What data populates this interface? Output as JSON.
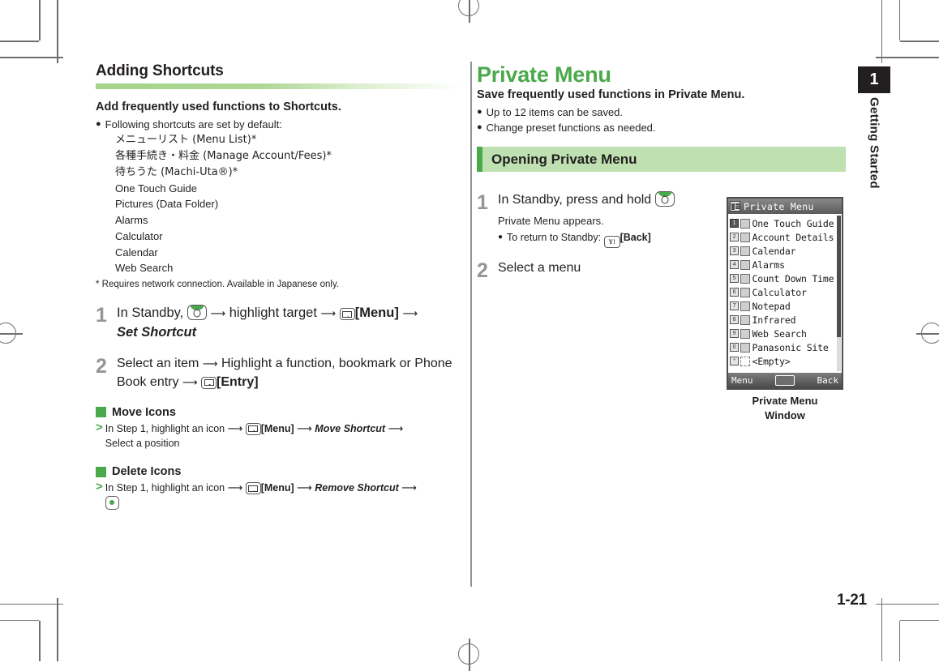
{
  "left": {
    "heading": "Adding Shortcuts",
    "lead": "Add frequently used functions to Shortcuts.",
    "bullet": "Following shortcuts are set by default:",
    "defaults": [
      "メニューリスト (Menu List)*",
      "各種手続き・料金 (Manage Account/Fees)*",
      "待ちうた (Machi-Uta®)*",
      "One Touch Guide",
      "Pictures (Data Folder)",
      "Alarms",
      "Calculator",
      "Calendar",
      "Web Search"
    ],
    "footnote": "* Requires network connection. Available in Japanese only.",
    "step1": {
      "num": "1",
      "pre": "In Standby,",
      "mid": "highlight target",
      "menu_label": "[Menu]",
      "emph": "Set Shortcut"
    },
    "step2": {
      "num": "2",
      "pre": "Select an item",
      "mid": "Highlight a function, bookmark or Phone Book entry",
      "entry_label": "[Entry]"
    },
    "move": {
      "title": "Move Icons",
      "pre": "In Step 1, highlight an icon",
      "menu_label": "[Menu]",
      "action": "Move Shortcut",
      "tail": "Select a position"
    },
    "delete": {
      "title": "Delete Icons",
      "pre": "In Step 1, highlight an icon",
      "menu_label": "[Menu]",
      "action": "Remove Shortcut"
    }
  },
  "right": {
    "heading": "Private Menu",
    "lead": "Save frequently used functions in Private Menu.",
    "bullets": [
      "Up to 12 items can be saved.",
      "Change preset functions as needed."
    ],
    "banner": "Opening Private Menu",
    "step1": {
      "num": "1",
      "text": "In Standby, press and hold",
      "note": "Private Menu appears.",
      "return_note": "To return to Standby:",
      "back_label": "[Back]"
    },
    "step2": {
      "num": "2",
      "text": "Select a menu"
    }
  },
  "phone": {
    "title": "Private Menu",
    "items": [
      {
        "n": "1",
        "label": "One Touch Guide",
        "selected": true
      },
      {
        "n": "2",
        "label": "Account Details",
        "selected": false
      },
      {
        "n": "3",
        "label": "Calendar",
        "selected": false
      },
      {
        "n": "4",
        "label": "Alarms",
        "selected": false
      },
      {
        "n": "5",
        "label": "Count Down Time",
        "selected": false
      },
      {
        "n": "6",
        "label": "Calculator",
        "selected": false
      },
      {
        "n": "7",
        "label": "Notepad",
        "selected": false
      },
      {
        "n": "8",
        "label": "Infrared",
        "selected": false
      },
      {
        "n": "9",
        "label": "Web Search",
        "selected": false
      },
      {
        "n": "0",
        "label": "Panasonic Site",
        "selected": false
      },
      {
        "n": "*",
        "label": "<Empty>",
        "selected": false
      }
    ],
    "softkeys": {
      "left": "Menu",
      "right": "Back"
    },
    "caption_line1": "Private Menu",
    "caption_line2": "Window"
  },
  "chapter": {
    "number": "1",
    "name": "Getting Started"
  },
  "page_number": "1-21",
  "colors": {
    "green": "#4aa94a",
    "light_green": "#bfe0b0",
    "gray": "#939598"
  }
}
